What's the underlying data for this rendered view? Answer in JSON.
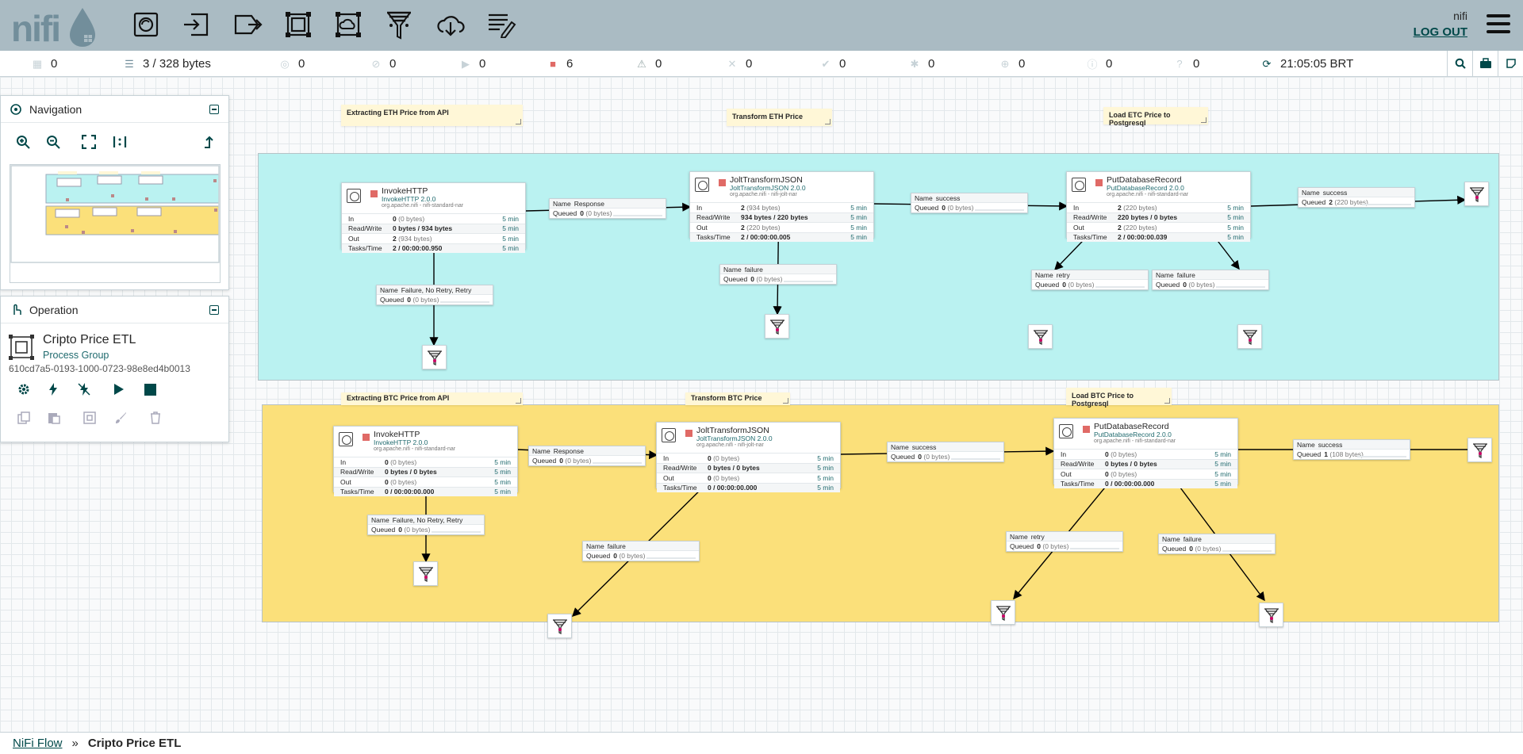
{
  "header": {
    "logo_text": "nifi",
    "user": "nifi",
    "logout_label": "LOG OUT",
    "toolbar": [
      "processor-icon",
      "input-port-icon",
      "output-port-icon",
      "process-group-icon",
      "remote-group-icon",
      "funnel-icon",
      "template-icon",
      "label-icon"
    ]
  },
  "status": {
    "transmitting": "0",
    "queued": "3 / 328 bytes",
    "transmitting_remote": "0",
    "not_transmitting_remote": "0",
    "running": "0",
    "stopped": "6",
    "invalid": "0",
    "disabled": "0",
    "up_to_date": "0",
    "locally_modified": "0",
    "stale": "0",
    "locally_modified_stale": "0",
    "sync_failure": "0",
    "last_refreshed": "21:05:05 BRT"
  },
  "navigation": {
    "title": "Navigation"
  },
  "operation": {
    "title": "Operation",
    "group_name": "Cripto Price ETL",
    "group_type": "Process Group",
    "group_id": "610cd7a5-0193-1000-0723-98e8ed4b0013"
  },
  "breadcrumb": {
    "root": "NiFi Flow",
    "separator": "»",
    "current": "Cripto Price ETL"
  },
  "colors": {
    "eth_group": "#baf2f1",
    "btc_group": "#fbe07a",
    "label_note": "#fff7d7",
    "stopped": "#e06a66",
    "accent": "#004849"
  },
  "eth": {
    "labels": {
      "extract": "Extracting ETH Price from API",
      "transform": "Transform ETH Price",
      "load": "Load ETC Price to Postgresql"
    },
    "invoke": {
      "name": "InvokeHTTP",
      "type": "InvokeHTTP 2.0.0",
      "bundle": "org.apache.nifi - nifi-standard-nar",
      "in_label": "In",
      "in_a": "0",
      "in_b": "(0 bytes)",
      "in_t": "5 min",
      "rw_label": "Read/Write",
      "rw": "0 bytes / 934 bytes",
      "rw_t": "5 min",
      "out_label": "Out",
      "out_a": "2",
      "out_b": "(934 bytes)",
      "out_t": "5 min",
      "tasks_label": "Tasks/Time",
      "tasks": "2 / 00:00:00.950",
      "tasks_t": "5 min"
    },
    "jolt": {
      "name": "JoltTransformJSON",
      "type": "JoltTransformJSON 2.0.0",
      "bundle": "org.apache.nifi - nifi-jolt-nar",
      "in_label": "In",
      "in_a": "2",
      "in_b": "(934 bytes)",
      "in_t": "5 min",
      "rw_label": "Read/Write",
      "rw": "934 bytes / 220 bytes",
      "rw_t": "5 min",
      "out_label": "Out",
      "out_a": "2",
      "out_b": "(220 bytes)",
      "out_t": "5 min",
      "tasks_label": "Tasks/Time",
      "tasks": "2 / 00:00:00.005",
      "tasks_t": "5 min"
    },
    "put": {
      "name": "PutDatabaseRecord",
      "type": "PutDatabaseRecord 2.0.0",
      "bundle": "org.apache.nifi - nifi-standard-nar",
      "in_label": "In",
      "in_a": "2",
      "in_b": "(220 bytes)",
      "in_t": "5 min",
      "rw_label": "Read/Write",
      "rw": "220 bytes / 0 bytes",
      "rw_t": "5 min",
      "out_label": "Out",
      "out_a": "2",
      "out_b": "(220 bytes)",
      "out_t": "5 min",
      "tasks_label": "Tasks/Time",
      "tasks": "2 / 00:00:00.039",
      "tasks_t": "5 min"
    },
    "conns": {
      "response": {
        "name": "Response",
        "queued_a": "0",
        "queued_b": "(0 bytes)"
      },
      "invoke_fail": {
        "name": "Failure, No Retry, Retry",
        "queued_a": "0",
        "queued_b": "(0 bytes)"
      },
      "jolt_success": {
        "name": "success",
        "queued_a": "0",
        "queued_b": "(0 bytes)"
      },
      "jolt_fail": {
        "name": "failure",
        "queued_a": "0",
        "queued_b": "(0 bytes)"
      },
      "put_success": {
        "name": "success",
        "queued_a": "2",
        "queued_b": "(220 bytes)"
      },
      "put_retry": {
        "name": "retry",
        "queued_a": "0",
        "queued_b": "(0 bytes)"
      },
      "put_fail": {
        "name": "failure",
        "queued_a": "0",
        "queued_b": "(0 bytes)"
      }
    }
  },
  "btc": {
    "labels": {
      "extract": "Extracting BTC Price from API",
      "transform": "Transform BTC Price",
      "load": "Load BTC Price to Postgresql"
    },
    "invoke": {
      "name": "InvokeHTTP",
      "type": "InvokeHTTP 2.0.0",
      "bundle": "org.apache.nifi - nifi-standard-nar",
      "in_label": "In",
      "in_a": "0",
      "in_b": "(0 bytes)",
      "in_t": "5 min",
      "rw_label": "Read/Write",
      "rw": "0 bytes / 0 bytes",
      "rw_t": "5 min",
      "out_label": "Out",
      "out_a": "0",
      "out_b": "(0 bytes)",
      "out_t": "5 min",
      "tasks_label": "Tasks/Time",
      "tasks": "0 / 00:00:00.000",
      "tasks_t": "5 min"
    },
    "jolt": {
      "name": "JoltTransformJSON",
      "type": "JoltTransformJSON 2.0.0",
      "bundle": "org.apache.nifi - nifi-jolt-nar",
      "in_label": "In",
      "in_a": "0",
      "in_b": "(0 bytes)",
      "in_t": "5 min",
      "rw_label": "Read/Write",
      "rw": "0 bytes / 0 bytes",
      "rw_t": "5 min",
      "out_label": "Out",
      "out_a": "0",
      "out_b": "(0 bytes)",
      "out_t": "5 min",
      "tasks_label": "Tasks/Time",
      "tasks": "0 / 00:00:00.000",
      "tasks_t": "5 min"
    },
    "put": {
      "name": "PutDatabaseRecord",
      "type": "PutDatabaseRecord 2.0.0",
      "bundle": "org.apache.nifi - nifi-standard-nar",
      "in_label": "In",
      "in_a": "0",
      "in_b": "(0 bytes)",
      "in_t": "5 min",
      "rw_label": "Read/Write",
      "rw": "0 bytes / 0 bytes",
      "rw_t": "5 min",
      "out_label": "Out",
      "out_a": "0",
      "out_b": "(0 bytes)",
      "out_t": "5 min",
      "tasks_label": "Tasks/Time",
      "tasks": "0 / 00:00:00.000",
      "tasks_t": "5 min"
    },
    "conns": {
      "response": {
        "name": "Response",
        "queued_a": "0",
        "queued_b": "(0 bytes)"
      },
      "invoke_fail": {
        "name": "Failure, No Retry, Retry",
        "queued_a": "0",
        "queued_b": "(0 bytes)"
      },
      "jolt_success": {
        "name": "success",
        "queued_a": "0",
        "queued_b": "(0 bytes)"
      },
      "jolt_fail": {
        "name": "failure",
        "queued_a": "0",
        "queued_b": "(0 bytes)"
      },
      "put_success": {
        "name": "success",
        "queued_a": "1",
        "queued_b": "(108 bytes)"
      },
      "put_retry": {
        "name": "retry",
        "queued_a": "0",
        "queued_b": "(0 bytes)"
      },
      "put_fail": {
        "name": "failure",
        "queued_a": "0",
        "queued_b": "(0 bytes)"
      }
    }
  },
  "text": {
    "name_key": "Name",
    "queued_key": "Queued"
  }
}
